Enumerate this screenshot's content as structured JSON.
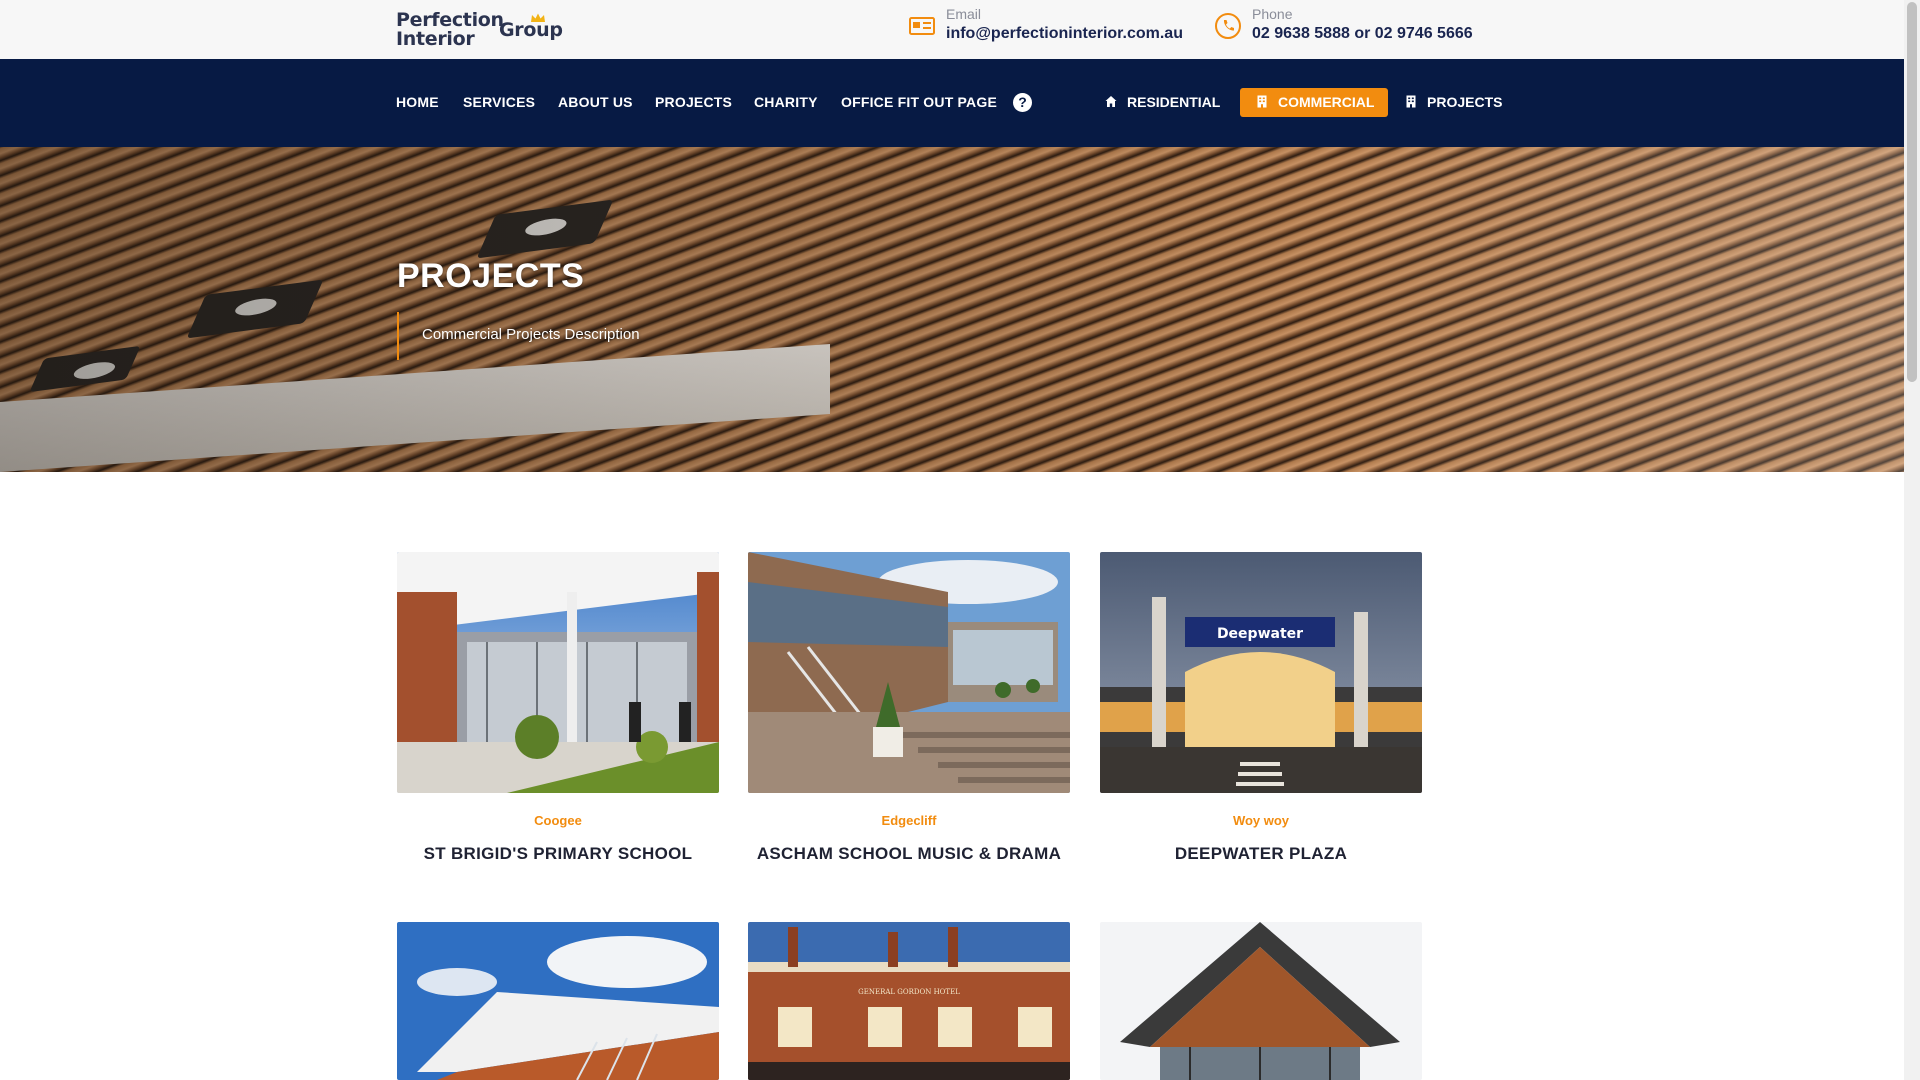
{
  "header": {
    "logo": {
      "line1": "Perfection",
      "line2": "Interior",
      "line3": "Group"
    },
    "email": {
      "label": "Email",
      "value": "info@perfectioninterior.com.au",
      "icon": "email-card-icon"
    },
    "phone": {
      "label": "Phone",
      "value": "02 9638 5888 or 02 9746 5666",
      "icon": "phone-icon"
    }
  },
  "nav": {
    "links": [
      "HOME",
      "SERVICES",
      "ABOUT US",
      "PROJECTS",
      "CHARITY",
      "OFFICE FIT OUT PAGE"
    ],
    "help_label": "?",
    "segments": [
      {
        "label": "RESIDENTIAL",
        "icon": "home-icon",
        "active": false
      },
      {
        "label": "COMMERCIAL",
        "icon": "building-icon",
        "active": true
      },
      {
        "label": "PROJECTS",
        "icon": "building-icon",
        "active": false
      }
    ]
  },
  "hero": {
    "title": "PROJECTS",
    "subtitle": "Commercial Projects Description"
  },
  "projects": [
    {
      "location": "Coogee",
      "title": "ST BRIGID'S PRIMARY SCHOOL"
    },
    {
      "location": "Edgecliff",
      "title": "ASCHAM SCHOOL MUSIC & DRAMA"
    },
    {
      "location": "Woy woy",
      "title": "DEEPWATER PLAZA"
    },
    {
      "location": "",
      "title": ""
    },
    {
      "location": "",
      "title": ""
    },
    {
      "location": "",
      "title": ""
    }
  ],
  "photo_signs": {
    "deepwater": "Deepwater",
    "gordon": "GENERAL GORDON HOTEL"
  },
  "colors": {
    "navy": "#071a44",
    "accent": "#f28c0f",
    "text_dark": "#1f2233"
  }
}
